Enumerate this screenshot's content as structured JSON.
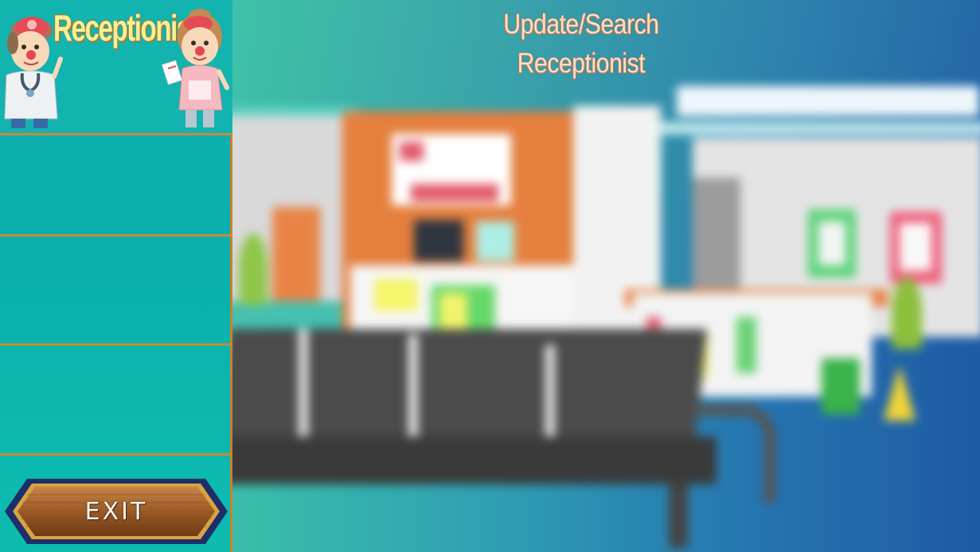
{
  "sidebar": {
    "header": {
      "title": "Receptionist",
      "icons": [
        "doctor-character-icon",
        "nurse-character-icon"
      ]
    },
    "slots": [
      "",
      "",
      ""
    ],
    "exit_button": {
      "label": "EXIT"
    }
  },
  "main": {
    "title_line1": "Update/Search",
    "title_line2": "Receptionist",
    "background": "hospital-lobby-reception-scene"
  },
  "colors": {
    "sidebar_bg": "#0aafae",
    "divider": "#c98a34",
    "title_text": "#fbe0c8",
    "exit_wood": "#a8652b",
    "exit_border": "#1d2e6b"
  }
}
